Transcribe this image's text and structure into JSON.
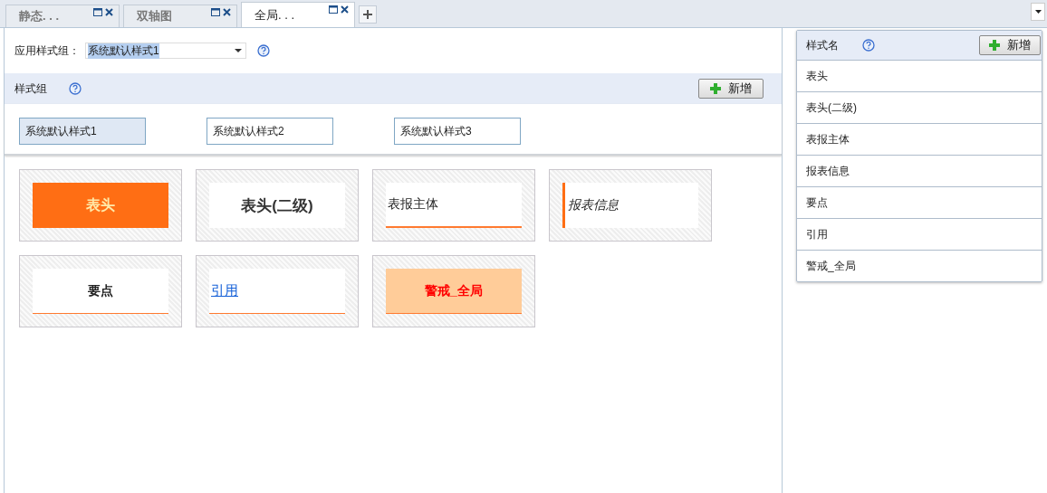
{
  "tabs": [
    {
      "label": "静态. . .",
      "selected": false
    },
    {
      "label": "双轴图",
      "selected": false
    },
    {
      "label": "全局. . .",
      "selected": true
    }
  ],
  "apply_group": {
    "label": "应用样式组：",
    "value": "系统默认样式1"
  },
  "style_group": {
    "title": "样式组",
    "add_button": "新增",
    "groups": [
      {
        "label": "系统默认样式1",
        "selected": true
      },
      {
        "label": "系统默认样式2",
        "selected": false
      },
      {
        "label": "系统默认样式3",
        "selected": false
      }
    ]
  },
  "previews": [
    {
      "kind": "header",
      "label": "表头"
    },
    {
      "kind": "subheader",
      "label": "表头(二级)"
    },
    {
      "kind": "body",
      "label": "表报主体"
    },
    {
      "kind": "info",
      "label": "报表信息"
    },
    {
      "kind": "keypoint",
      "label": "要点"
    },
    {
      "kind": "quote",
      "label": "引用"
    },
    {
      "kind": "alert",
      "label": "警戒_全局"
    }
  ],
  "style_names": {
    "title": "样式名",
    "add_button": "新增",
    "items": [
      "表头",
      "表头(二级)",
      "表报主体",
      "报表信息",
      "要点",
      "引用",
      "警戒_全局"
    ]
  }
}
